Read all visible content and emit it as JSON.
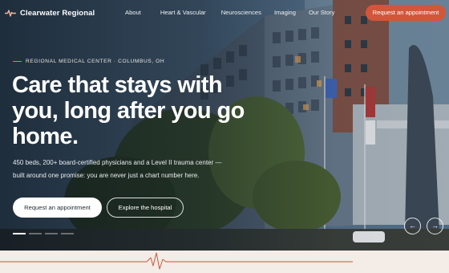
{
  "nav": {
    "brand": "Clearwater Regional",
    "brand_icon": "heartbeat-icon",
    "links": [
      "About",
      "Heart & Vascular",
      "Neurosciences",
      "Imaging",
      "Our Story"
    ],
    "cta": "Request an appointment"
  },
  "hero": {
    "eyebrow": "REGIONAL MEDICAL CENTER · COLUMBUS, OH",
    "headline": "Care that stays with you, long after you go home.",
    "subcopy": "450 beds, 200+ board-certified physicians and a Level II trauma center — built around one promise: you are never just a chart number here.",
    "primary_cta": "Request an appointment",
    "secondary_cta": "Explore the hospital",
    "slides": {
      "count": 4,
      "active": 1
    },
    "prev_icon": "arrow-left-icon",
    "next_icon": "arrow-right-icon"
  },
  "colors": {
    "accent": "#d2563a",
    "eyebrow_line": "#e8775a",
    "pulse_line": "#c9573c",
    "band_background": "#f4ece6"
  }
}
